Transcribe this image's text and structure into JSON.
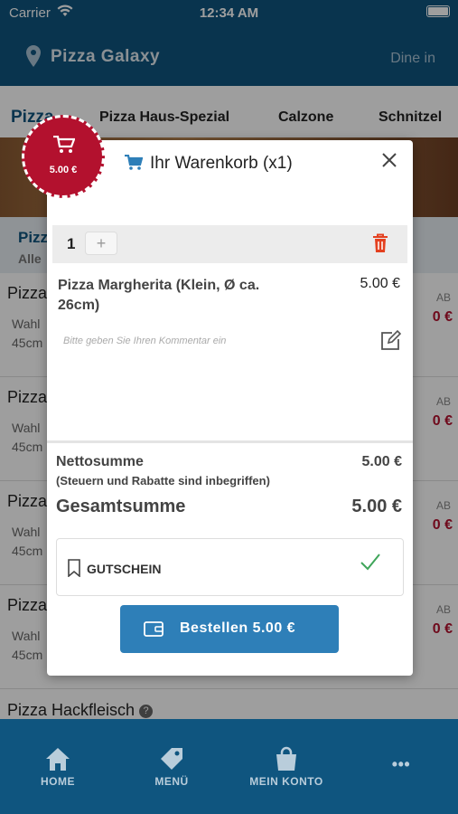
{
  "status_bar": {
    "carrier": "Carrier",
    "time": "12:34 AM"
  },
  "header": {
    "restaurant": "Pizza Galaxy",
    "mode": "Dine in"
  },
  "categories": [
    "Pizza",
    "Pizza Haus-Spezial",
    "Calzone",
    "Schnitzel"
  ],
  "subcategory": {
    "title": "Pizza",
    "subtitle": "Alle"
  },
  "menu_items": [
    {
      "name": "Pizza",
      "desc1": "Wahl",
      "desc2": "45cm",
      "tag": "AB",
      "price": "0 €"
    },
    {
      "name": "Pizza",
      "desc1": "Wahl",
      "desc2": "45cm",
      "tag": "AB",
      "price": "0 €"
    },
    {
      "name": "Pizza",
      "desc1": "Wahl",
      "desc2": "45cm",
      "tag": "AB",
      "price": "0 €"
    },
    {
      "name": "Pizza",
      "desc1": "Wahl",
      "desc2": "45cm",
      "tag": "AB",
      "price": "0 €"
    }
  ],
  "last_item": {
    "name": "Pizza Hackfleisch",
    "help": "?"
  },
  "tabbar": {
    "home": "HOME",
    "menu": "MENÜ",
    "account": "MEIN KONTO",
    "more": "•••"
  },
  "badge": {
    "price": "5.00 €"
  },
  "cart": {
    "title": "Ihr Warenkorb (x1)",
    "quantity": "1",
    "plus": "+",
    "product_name": "Pizza Margherita (Klein, Ø ca. 26cm)",
    "product_price": "5.00 €",
    "comment_placeholder": "Bitte geben Sie Ihren Kommentar ein",
    "net_label": "Nettosumme",
    "net_note": "(Steuern und Rabatte sind inbegriffen)",
    "net_value": "5.00 €",
    "total_label": "Gesamtsumme",
    "total_value": "5.00 €",
    "voucher_label": "GUTSCHEIN",
    "order_label": "Bestellen 5.00 €"
  },
  "colors": {
    "primary": "#0f557f",
    "accent": "#b3112e",
    "button": "#2e7fb8",
    "success": "#3fa55a"
  }
}
